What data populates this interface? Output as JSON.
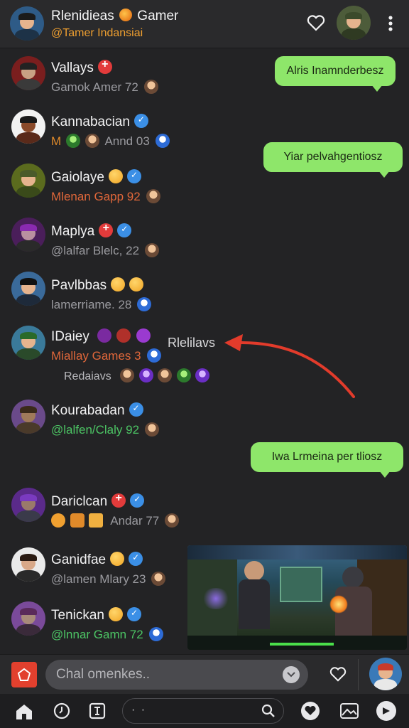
{
  "header": {
    "title_left": "Rlenidieas",
    "title_right": "Gamer",
    "subtitle": "@Tamer Indansiai"
  },
  "contacts": [
    {
      "name": "Vallays",
      "sub": "Gamok Amer 72",
      "sub_color": "#9a9a9f"
    },
    {
      "name": "Kannabacian",
      "sub": "Annd 03",
      "sub_color": "#9a9a9f"
    },
    {
      "name": "Gaiolaye",
      "sub": "Mlenan Gapp 92",
      "sub_color": "#e0673a"
    },
    {
      "name": "Maplya",
      "sub": "@lalfar Blelc, 22",
      "sub_color": "#9a9a9f"
    },
    {
      "name": "Pavlbbas",
      "sub": "lamerriame. 28",
      "sub_color": "#9a9a9f"
    },
    {
      "name": "IDaiey",
      "sub": "Miallay Games 3",
      "sub_color": "#e0673a",
      "extra": "Redaiavs"
    },
    {
      "name": "Kourabadan",
      "sub": "@lalfen/Claly 92",
      "sub_color": "#4cc464"
    },
    {
      "name": "Dariclcan",
      "sub": "Andar 77",
      "sub_color": "#9a9a9f"
    },
    {
      "name": "Ganidfae",
      "sub": "@lamen Mlary 23",
      "sub_color": "#9a9a9f"
    },
    {
      "name": "Tenickan",
      "sub": "@lnnar Gamn 72",
      "sub_color": "#4cc464"
    }
  ],
  "messages": [
    {
      "text": "Alris Inamnderbesz"
    },
    {
      "text": "Yiar pelvahgentiosz"
    },
    {
      "text": "Iwa Lrmeina per tliosz"
    }
  ],
  "annotation": {
    "label": "Rlelilavs"
  },
  "composer": {
    "placeholder": "Chal omenkes.."
  },
  "nav": {
    "search_dots": "· ·"
  },
  "colors": {
    "bubble": "#8ee66a",
    "arrow": "#e23b2b",
    "accent_orange": "#f0a030"
  }
}
